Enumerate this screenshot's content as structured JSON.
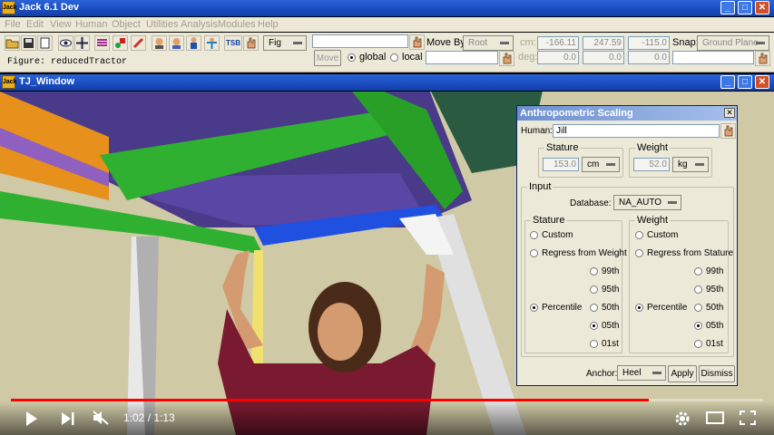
{
  "app": {
    "title": "Jack 6.1 Dev"
  },
  "menu": [
    "File",
    "Edit",
    "View",
    "Human",
    "Object",
    "Utilities",
    "Analysis",
    "Modules",
    "Help"
  ],
  "toolbar": {
    "fig_select": "Fig",
    "tsb_label": "TSB",
    "figure_label": "Figure: reducedTractor",
    "move_by_label": "Move By:",
    "move_by_value": "Root",
    "move_button": "Move",
    "frame_global": "global",
    "frame_local": "local",
    "cm_label": "cm:",
    "deg_label": "deg:",
    "cm_values": [
      "-166.11",
      "247.59",
      "-115.0"
    ],
    "deg_values": [
      "0.0",
      "0.0",
      "0.0"
    ],
    "snap_label": "Snap:",
    "snap_value": "Ground Plane"
  },
  "window": {
    "title": "TJ_Window"
  },
  "dialog": {
    "title": "Anthropometric Scaling",
    "human_label": "Human:",
    "human_value": "Jill",
    "stature_group": "Stature",
    "stature_value": "153.0",
    "stature_unit": "cm",
    "weight_group": "Weight",
    "weight_value": "52.0",
    "weight_unit": "kg",
    "input_group": "Input",
    "database_label": "Database:",
    "database_value": "NA_AUTO",
    "stature_col": {
      "title": "Stature",
      "custom": "Custom",
      "regress": "Regress from Weight",
      "percentile": "Percentile"
    },
    "weight_col": {
      "title": "Weight",
      "custom": "Custom",
      "regress": "Regress from Stature",
      "percentile": "Percentile"
    },
    "percentiles": [
      "99th",
      "95th",
      "50th",
      "05th",
      "01st"
    ],
    "selected_percentile": "05th",
    "anchor_label": "Anchor:",
    "anchor_value": "Heel",
    "apply_button": "Apply",
    "dismiss_button": "Dismiss"
  },
  "player": {
    "time": "1:02 / 1:13",
    "progress": 0.848
  },
  "colors": {
    "titlebar": "#1a4cc0",
    "progress": "#ff0000",
    "chrome": "#ece9d8"
  }
}
